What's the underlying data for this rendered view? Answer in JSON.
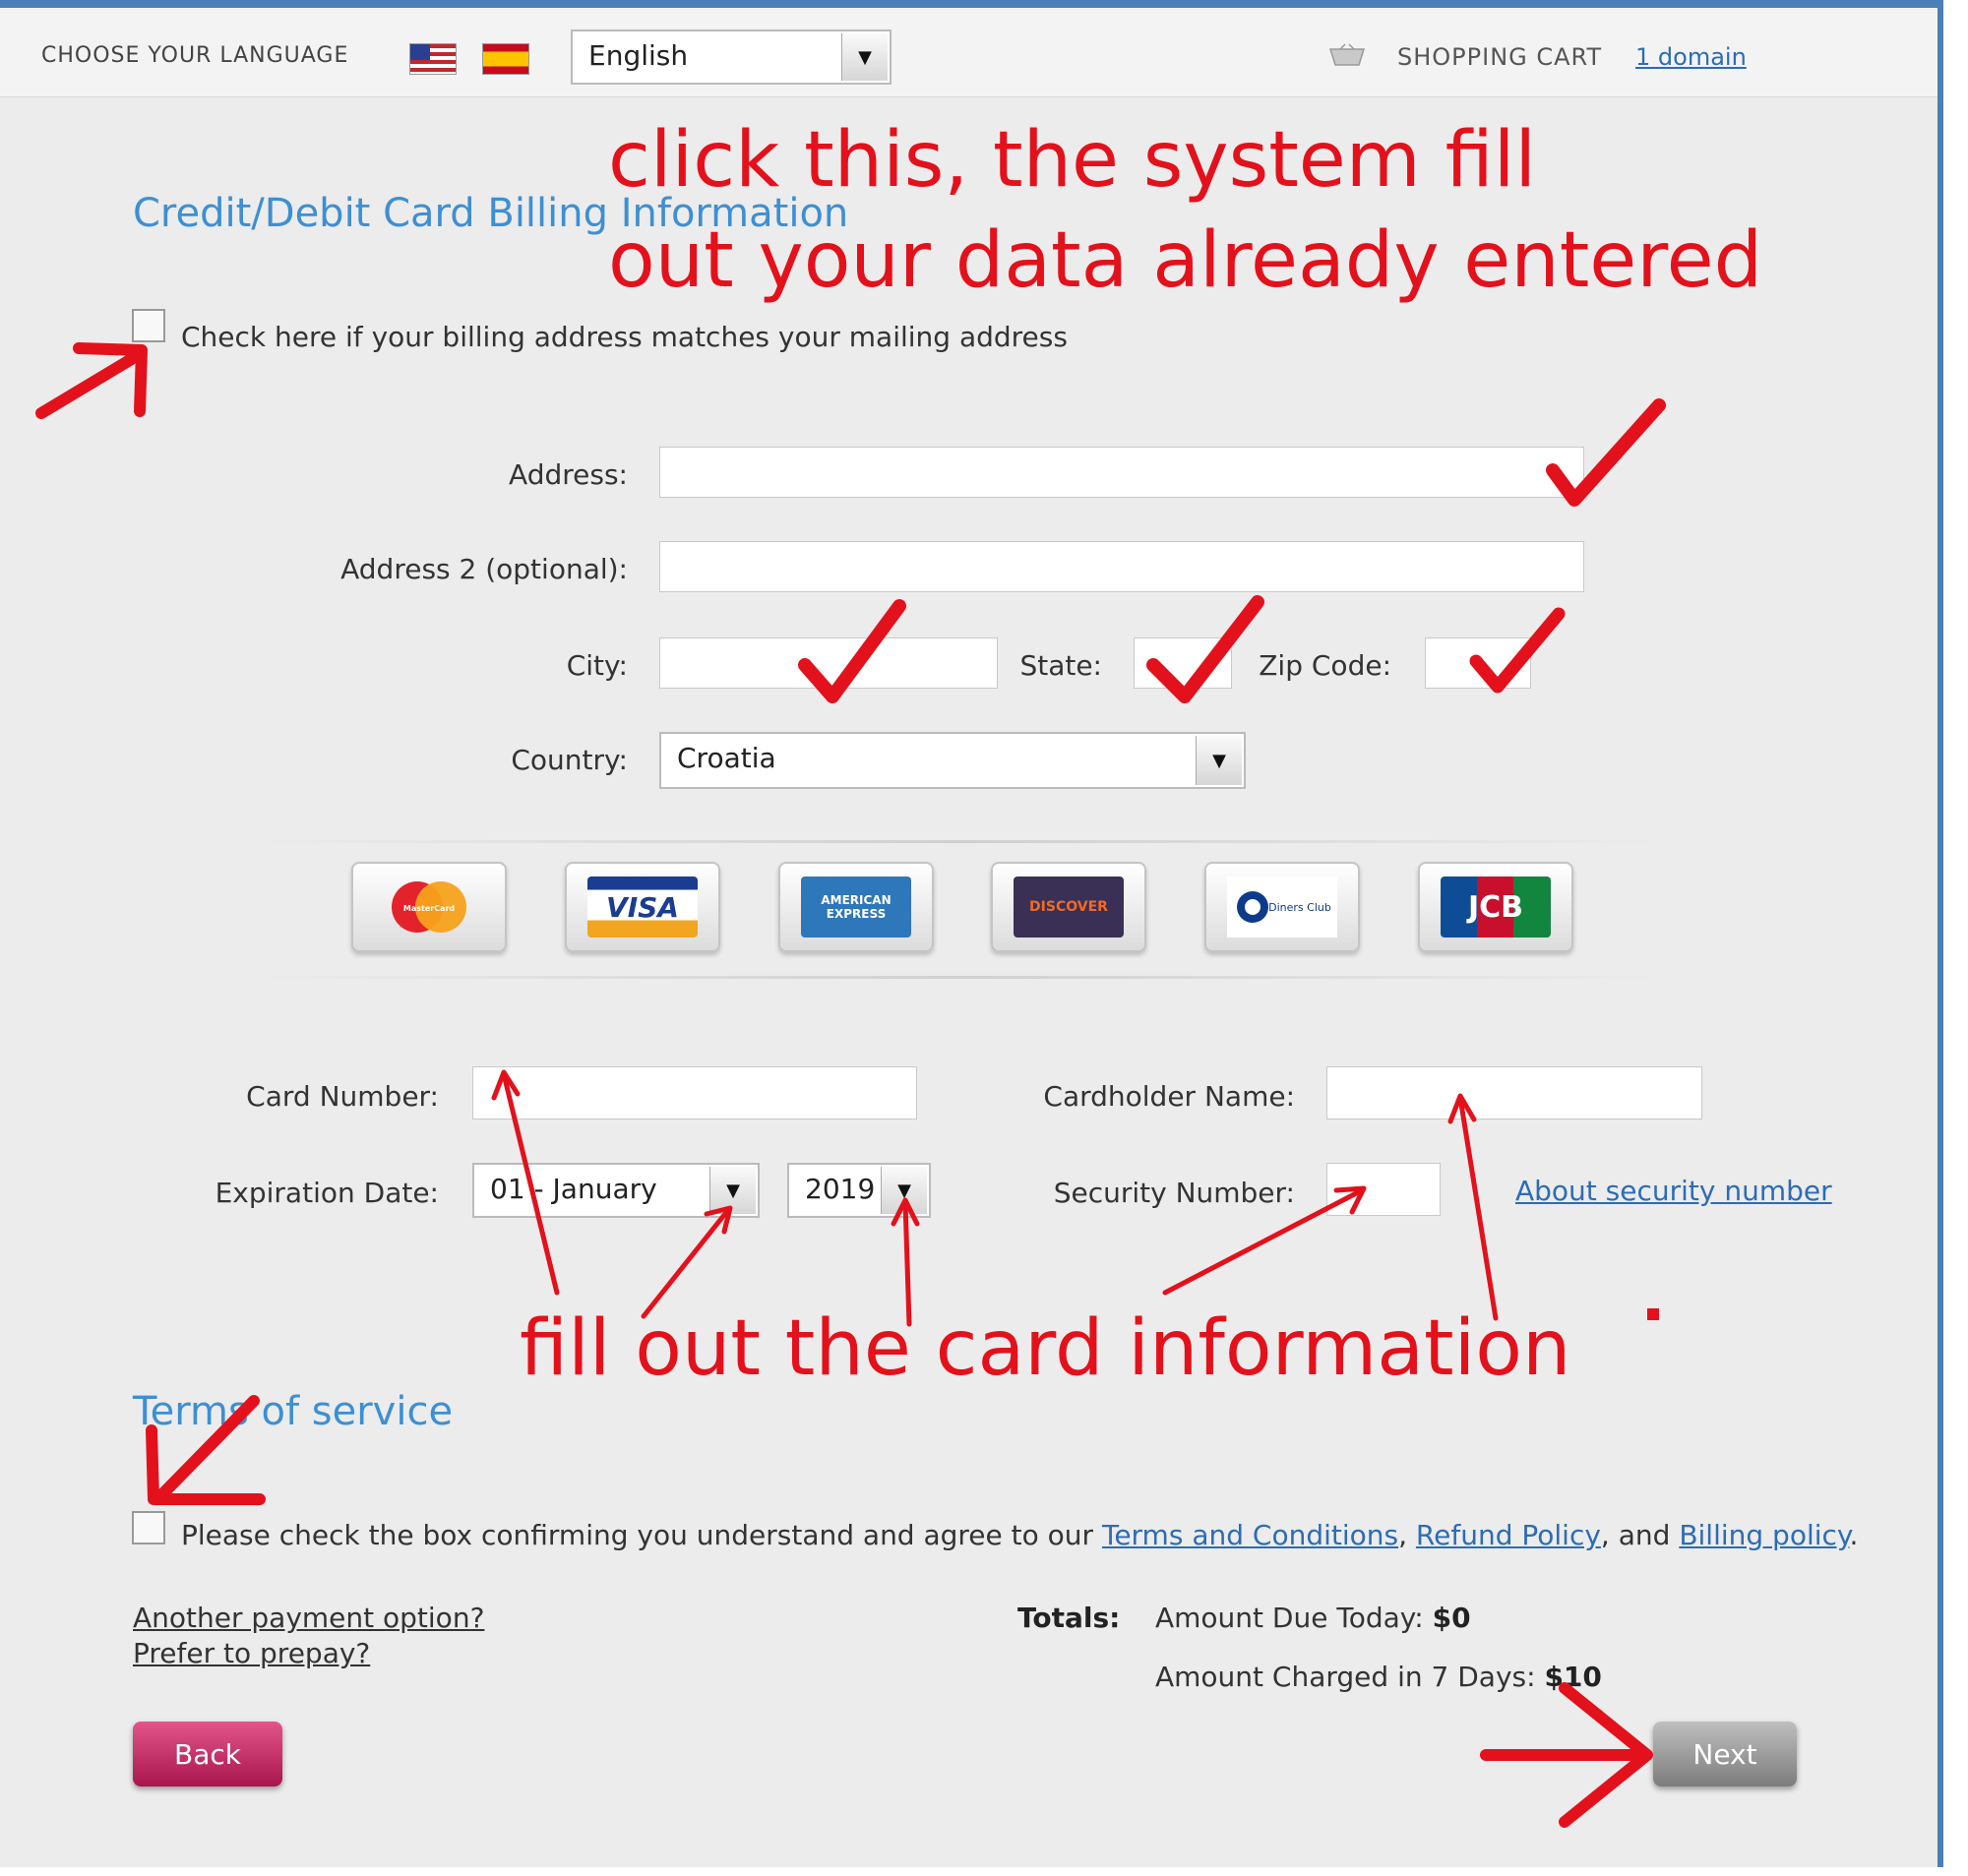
{
  "header": {
    "language_label": "CHOOSE YOUR LANGUAGE",
    "language_selected": "English",
    "cart_label": "SHOPPING CART",
    "cart_link": "1 domain"
  },
  "billing": {
    "title": "Credit/Debit Card Billing Information",
    "same_address_label": "Check here if your billing address matches your mailing address",
    "address_label": "Address:",
    "address2_label": "Address 2 (optional):",
    "city_label": "City:",
    "state_label": "State:",
    "zip_label": "Zip Code:",
    "country_label": "Country:",
    "country_selected": "Croatia"
  },
  "cards": [
    {
      "name": "MasterCard",
      "icon": "mastercard-icon"
    },
    {
      "name": "VISA",
      "icon": "visa-icon"
    },
    {
      "name": "AMERICAN EXPRESS",
      "icon": "amex-icon"
    },
    {
      "name": "DISCOVER",
      "icon": "discover-icon"
    },
    {
      "name": "Diners Club",
      "icon": "diners-icon"
    },
    {
      "name": "JCB",
      "icon": "jcb-icon"
    }
  ],
  "card_info": {
    "card_number_label": "Card Number:",
    "cardholder_label": "Cardholder Name:",
    "expiration_label": "Expiration Date:",
    "exp_month": "01 - January",
    "exp_year": "2019",
    "security_label": "Security Number:",
    "security_link": "About security number"
  },
  "terms": {
    "title": "Terms of service",
    "agree_text": "Please check the box confirming you understand and agree to our",
    "terms_link": "Terms and Conditions",
    "sep1": ",",
    "refund_link": "Refund Policy",
    "sep2": ", and",
    "billing_link": "Billing policy",
    "end": "."
  },
  "footer": {
    "another_payment": "Another payment option?",
    "prepay": "Prefer to prepay?",
    "totals_label": "Totals:",
    "due_today_label": "Amount Due Today:",
    "due_today_value": "$0",
    "charged_label": "Amount Charged in 7 Days:",
    "charged_value": "$10",
    "back_label": "Back",
    "next_label": "Next"
  },
  "annotations": {
    "line1": "click this, the system fill",
    "line2": "out your data already entered",
    "line3": "fill out the card information"
  },
  "colors": {
    "accent_blue": "#3d8fd3",
    "annotation_red": "#e3111b",
    "back_button": "#c0295f",
    "next_button": "#9a9a9a"
  }
}
